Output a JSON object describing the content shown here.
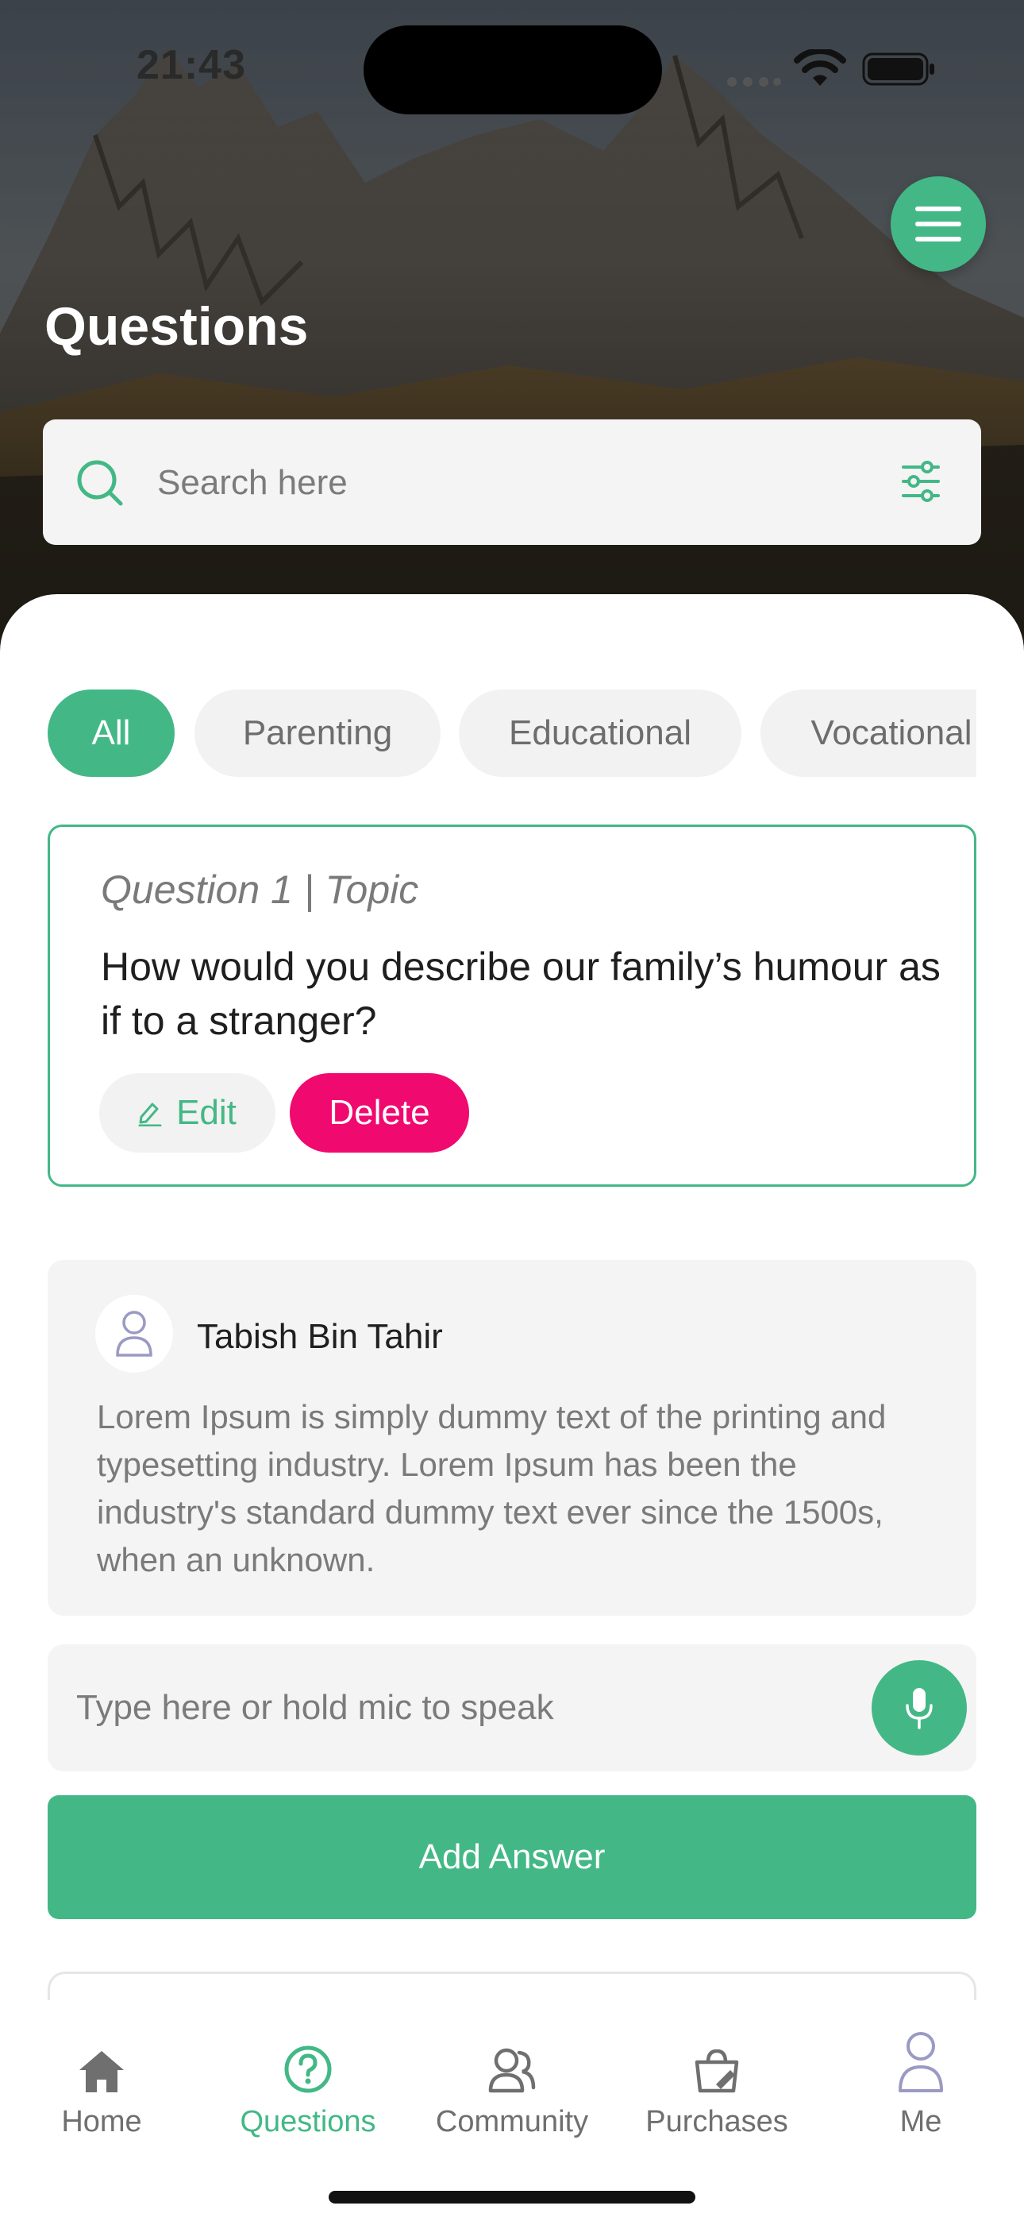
{
  "status_bar": {
    "time": "21:43"
  },
  "header": {
    "title": "Questions",
    "menu_icon": "hamburger-menu-icon"
  },
  "search": {
    "placeholder": "Search here"
  },
  "categories": [
    {
      "label": "All",
      "selected": true
    },
    {
      "label": "Parenting",
      "selected": false
    },
    {
      "label": "Educational",
      "selected": false
    },
    {
      "label": "Vocational",
      "selected": false
    }
  ],
  "question": {
    "meta": "Question 1 | Topic",
    "text": "How would you describe our family’s humour as if to a stranger?",
    "edit_label": "Edit",
    "delete_label": "Delete"
  },
  "answer": {
    "author": "Tabish Bin Tahir",
    "text": "Lorem Ipsum is simply dummy text of the printing and typesetting industry. Lorem Ipsum has been the industry's standard dummy text ever since the 1500s, when an unknown."
  },
  "answer_input": {
    "placeholder": "Type here or hold mic to speak",
    "submit_label": "Add Answer"
  },
  "bottom_nav": [
    {
      "label": "Home",
      "icon": "home-icon",
      "active": false
    },
    {
      "label": "Questions",
      "icon": "question-circle-icon",
      "active": true
    },
    {
      "label": "Community",
      "icon": "community-icon",
      "active": false
    },
    {
      "label": "Purchases",
      "icon": "purchases-bag-icon",
      "active": false
    },
    {
      "label": "Me",
      "icon": "profile-icon",
      "active": false
    }
  ],
  "colors": {
    "accent": "#43b886",
    "danger": "#f0096e",
    "muted_text": "#7a7a7a"
  }
}
